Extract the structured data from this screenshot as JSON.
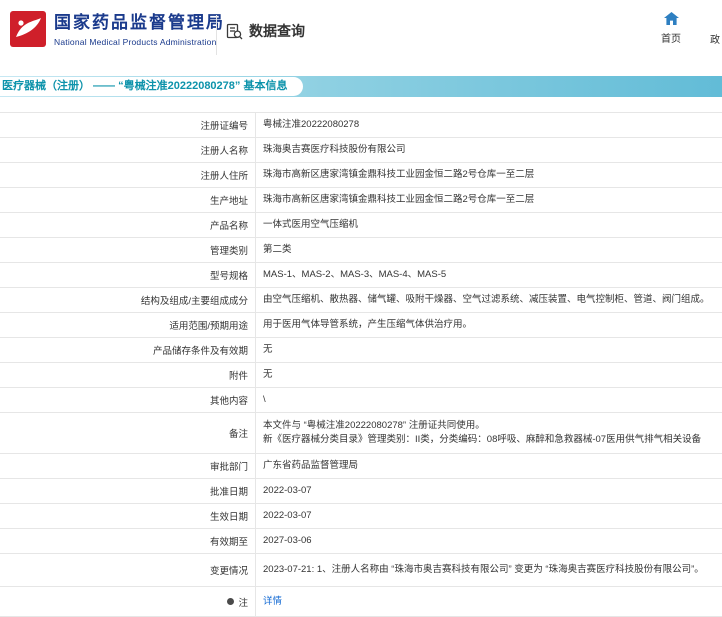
{
  "header": {
    "title": "国家药品监督管理局",
    "subtitle": "National Medical Products Administration",
    "section": "数据查询",
    "nav_home": "首页",
    "nav_partial": "政"
  },
  "banner": {
    "title": "医疗器械（注册） —— “粤械注准20222080278” 基本信息"
  },
  "table": {
    "rows": [
      {
        "label": "注册证编号",
        "value": "粤械注准20222080278"
      },
      {
        "label": "注册人名称",
        "value": "珠海奥吉赛医疗科技股份有限公司"
      },
      {
        "label": "注册人住所",
        "value": "珠海市高新区唐家湾镇金鼎科技工业园金恒二路2号仓库一至二层"
      },
      {
        "label": "生产地址",
        "value": "珠海市高新区唐家湾镇金鼎科技工业园金恒二路2号仓库一至二层"
      },
      {
        "label": "产品名称",
        "value": "一体式医用空气压缩机"
      },
      {
        "label": "管理类别",
        "value": "第二类"
      },
      {
        "label": "型号规格",
        "value": "MAS-1、MAS-2、MAS-3、MAS-4、MAS-5"
      },
      {
        "label": "结构及组成/主要组成成分",
        "value": "由空气压缩机、散热器、储气罐、吸附干燥器、空气过滤系统、减压装置、电气控制柜、管道、阀门组成。"
      },
      {
        "label": "适用范围/预期用途",
        "value": "用于医用气体导管系统，产生压缩气体供治疗用。"
      },
      {
        "label": "产品储存条件及有效期",
        "value": "无"
      },
      {
        "label": "附件",
        "value": "无"
      },
      {
        "label": "其他内容",
        "value": "\\"
      },
      {
        "label": "备注",
        "value": "本文件与 “粤械注准20222080278” 注册证共同使用。\n新《医疗器械分类目录》管理类别：II类，分类编码：08呼吸、麻醉和急救器械-07医用供气排气相关设备"
      },
      {
        "label": "审批部门",
        "value": "广东省药品监督管理局"
      },
      {
        "label": "批准日期",
        "value": "2022-03-07"
      },
      {
        "label": "生效日期",
        "value": "2022-03-07"
      },
      {
        "label": "有效期至",
        "value": "2027-03-06"
      },
      {
        "label": "变更情况",
        "value": "2023-07-21: 1、注册人名称由 “珠海市奥吉赛科技有限公司” 变更为 “珠海奥吉赛医疗科技股份有限公司”。"
      },
      {
        "label": "注",
        "value": "详情"
      }
    ]
  },
  "icons": {
    "emblem": "nmpa-emblem-icon",
    "section": "document-search-icon",
    "home": "home-icon",
    "note": "note-bullet-icon"
  },
  "colors": {
    "brand_blue": "#1a3a8c",
    "emblem_red": "#cf1f2a",
    "banner_teal_text": "#0d93ab",
    "banner_band": "#62bcd7",
    "link_blue": "#1269d3",
    "border_gray": "#e6e6e6"
  }
}
